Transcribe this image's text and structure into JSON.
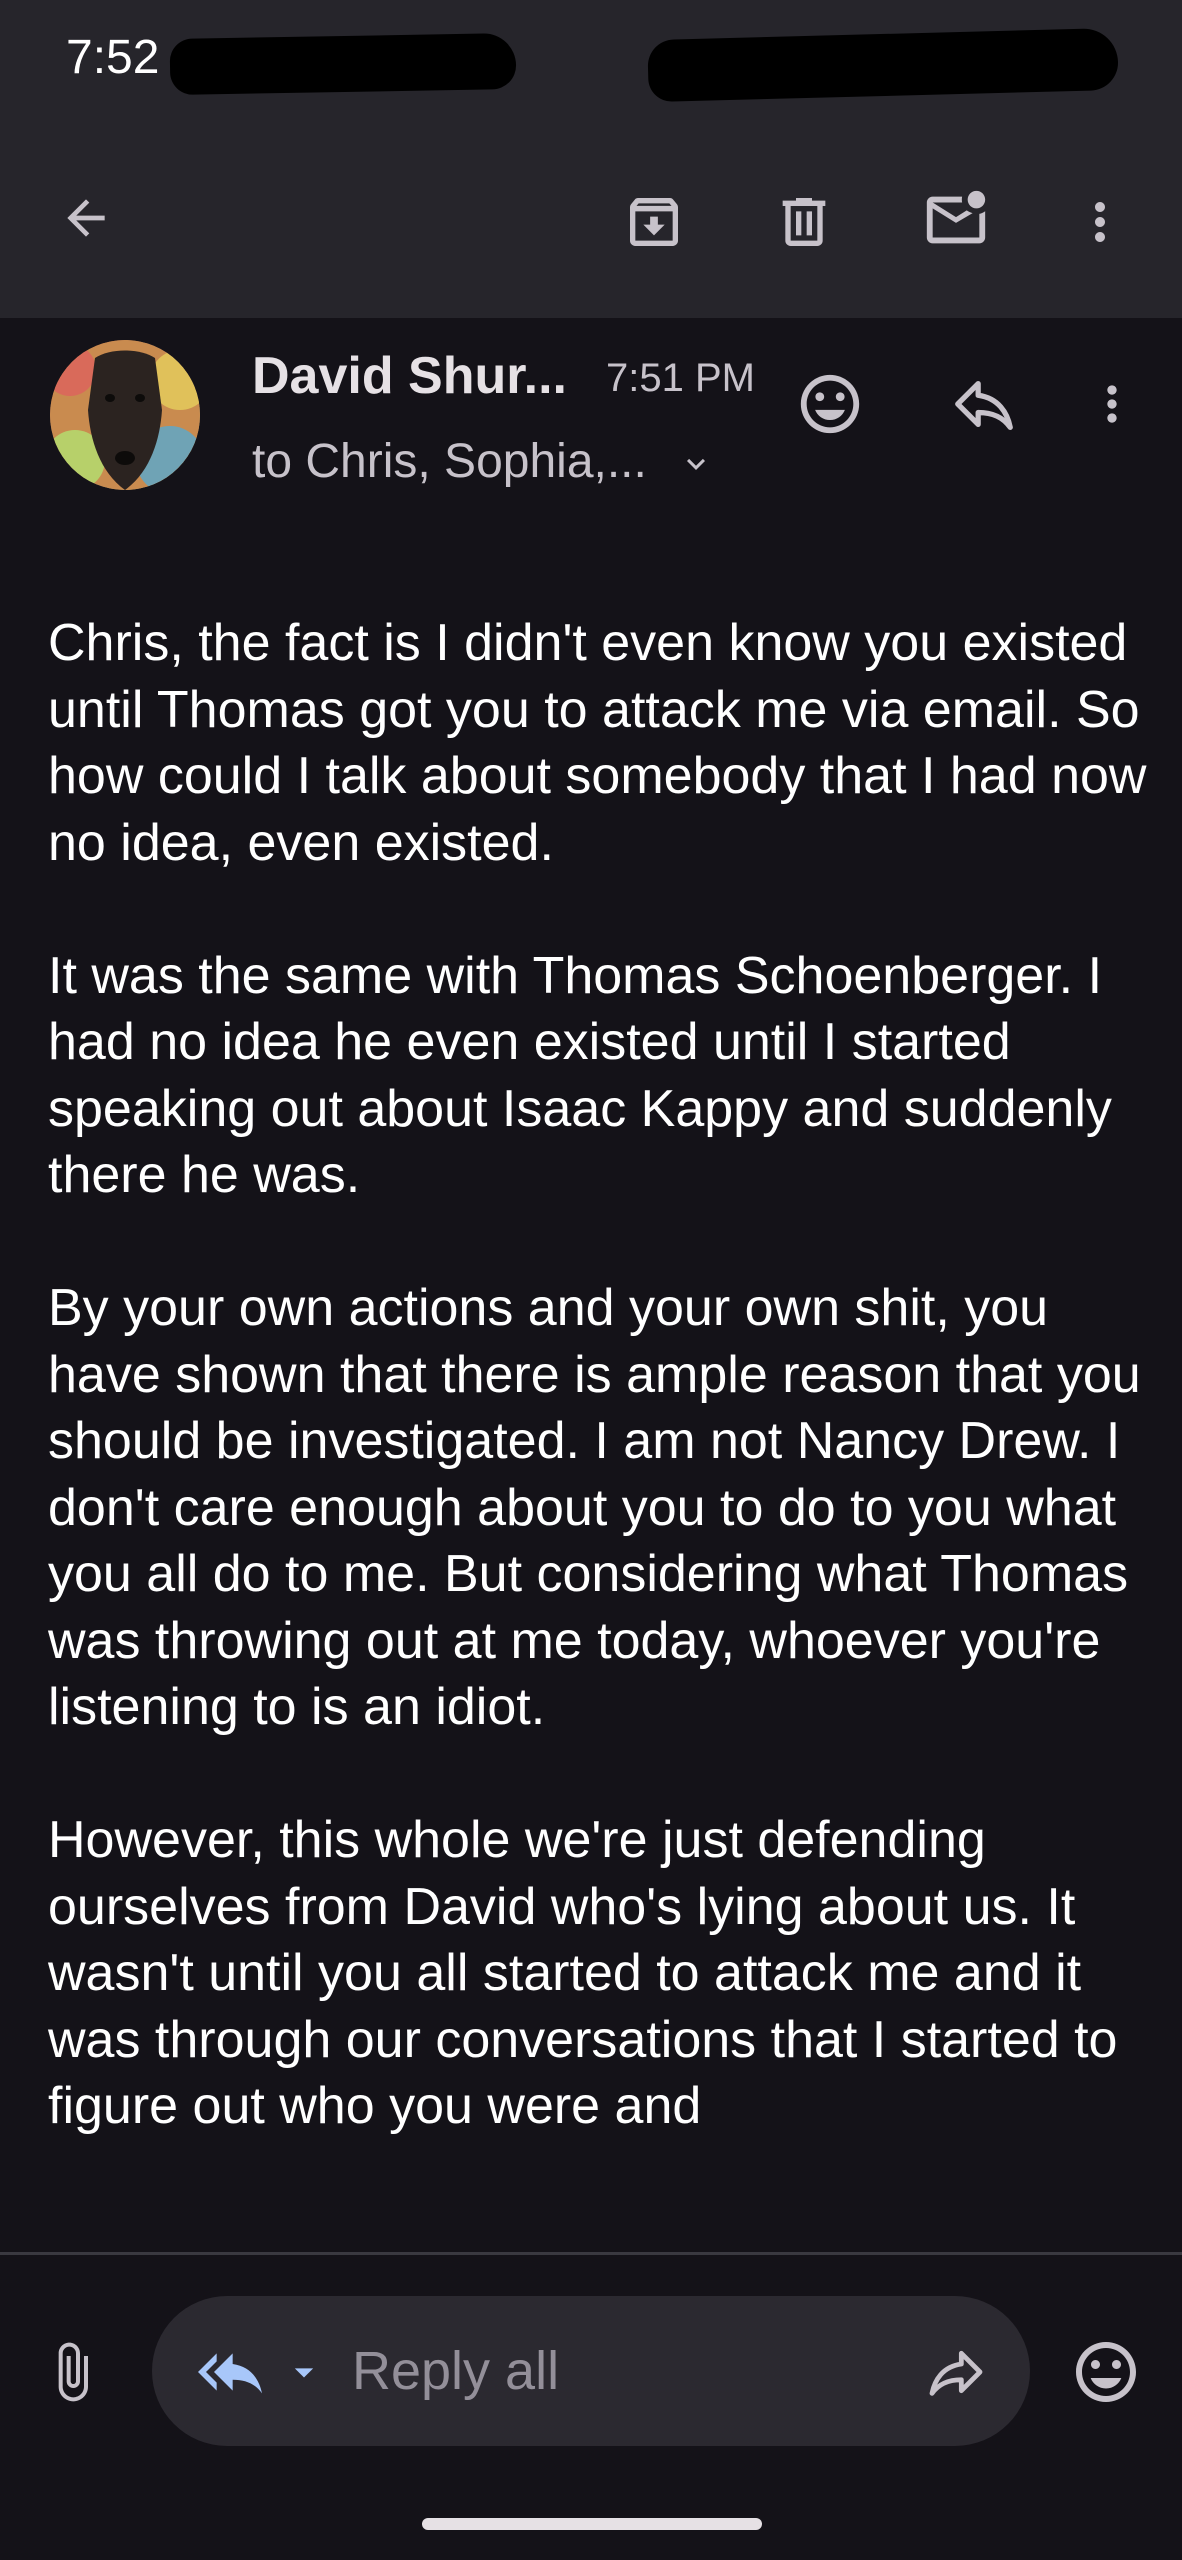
{
  "status_bar": {
    "time": "7:52"
  },
  "toolbar": {
    "back_icon": "arrow-left-icon",
    "archive_icon": "archive-icon",
    "delete_icon": "trash-icon",
    "mark_unread_icon": "mail-unread-icon",
    "more_icon": "more-vertical-icon"
  },
  "message": {
    "sender": "David Shur...",
    "time": "7:51 PM",
    "recipients": "to Chris, Sophia,...",
    "paragraphs": [
      "Chris, the fact is I didn't even know you existed until Thomas got you to attack me via email. So how could I talk about somebody that I had now no idea, even existed.",
      "It was the same with Thomas Schoenberger. I had no idea he even existed until I started speaking out about Isaac Kappy and suddenly there he was.",
      "By your own actions and your own shit, you have shown that there is ample reason that you should be investigated. I am not Nancy Drew. I don't care enough about you to do to you what you all do to me. But considering what Thomas was throwing out at me today, whoever you're listening to is an idiot.",
      "However, this whole we're just defending ourselves from David who's lying about us. It wasn't until you all started to attack me and it was through our conversations that I started to figure out who you were and"
    ]
  },
  "reply_bar": {
    "placeholder": "Reply all"
  },
  "colors": {
    "toolbar_bg": "#26252b",
    "page_bg": "#141218",
    "reply_pill_bg": "#2b2930",
    "reply_accent": "#a8c7fa"
  }
}
